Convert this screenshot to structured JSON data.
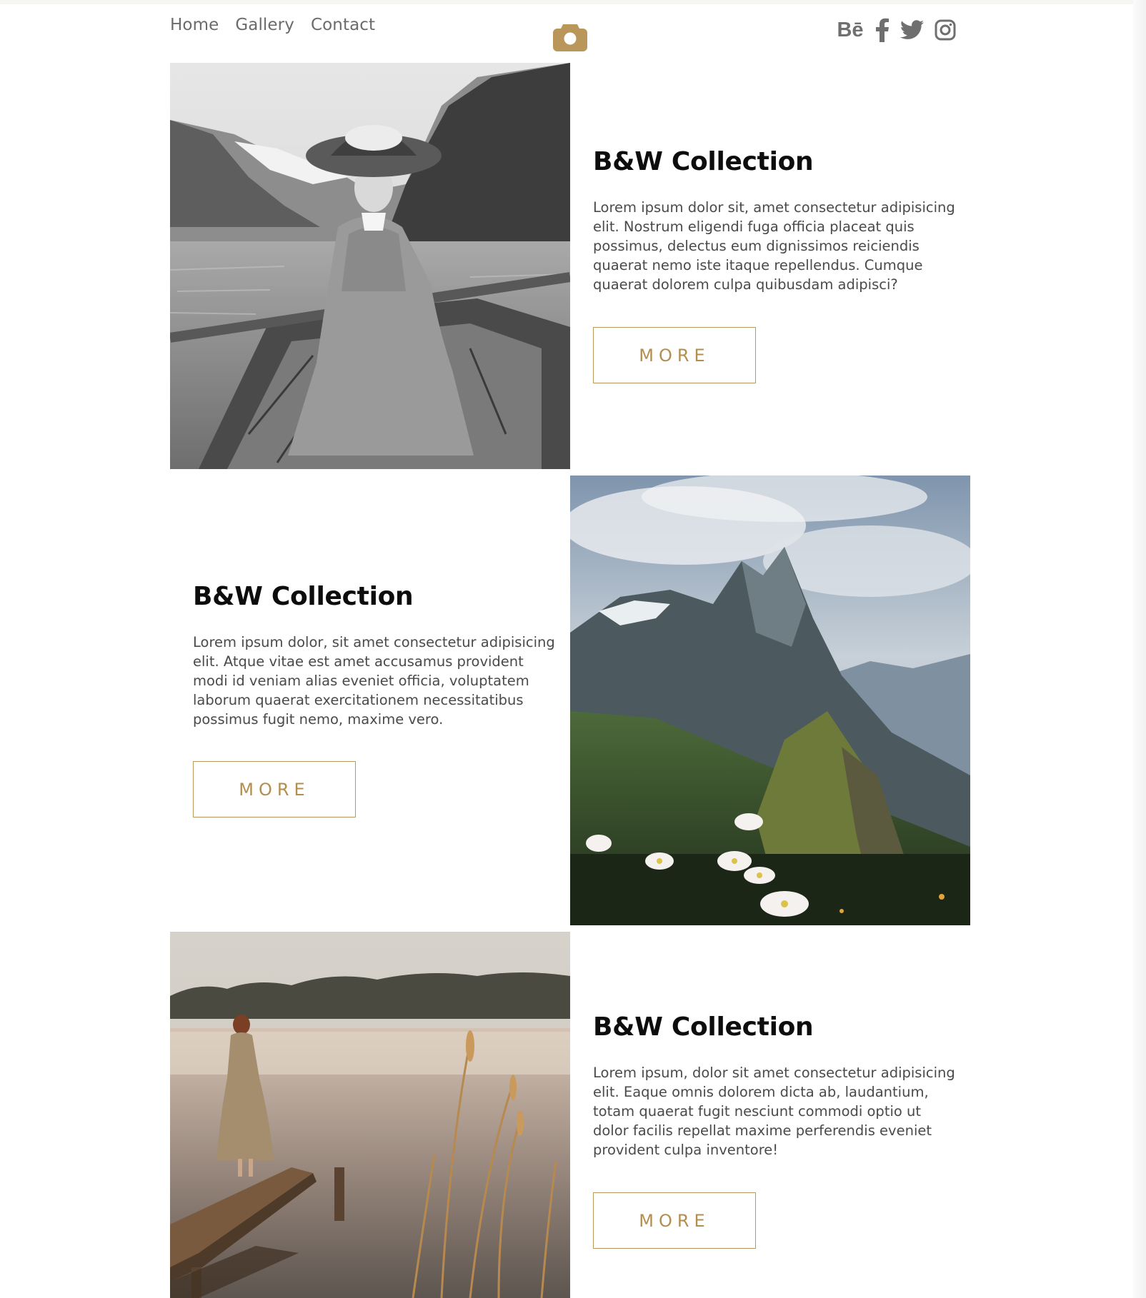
{
  "nav": {
    "items": [
      {
        "label": "Home"
      },
      {
        "label": "Gallery"
      },
      {
        "label": "Contact"
      }
    ]
  },
  "logo": {
    "icon": "camera-icon",
    "color": "#b9965a"
  },
  "social": {
    "behance": "Bē",
    "icons": [
      "behance-icon",
      "facebook-icon",
      "twitter-icon",
      "instagram-icon"
    ]
  },
  "sections": [
    {
      "title": "B&W Collection",
      "text": "Lorem ipsum dolor sit, amet consectetur adipisicing elit. Nostrum eligendi fuga officia placeat quis possimus, delectus eum dignissimos reiciendis quaerat nemo iste itaque repellendus. Cumque quaerat dolorem culpa quibusdam adipisci?",
      "button": "MORE",
      "image": "woman-rowing-boat-photo"
    },
    {
      "title": "B&W Collection",
      "text": "Lorem ipsum dolor, sit amet consectetur adipisicing elit. Atque vitae est amet accusamus provident modi id veniam alias eveniet officia, voluptatem laborum quaerat exercitationem necessitatibus possimus fugit nemo, maxime vero.",
      "button": "MORE",
      "image": "mountain-flowers-photo"
    },
    {
      "title": "B&W Collection",
      "text": "Lorem ipsum, dolor sit amet consectetur adipisicing elit. Eaque omnis dolorem dicta ab, laudantium, totam quaerat fugit nesciunt commodi optio ut dolor facilis repellat maxime perferendis eveniet provident culpa inventore!",
      "button": "MORE",
      "image": "woman-on-pier-photo"
    }
  ],
  "colors": {
    "accent": "#b9965a",
    "nav_text": "#6b6b6b",
    "heading": "#0d0d0d",
    "body_text": "#4a4a4a"
  }
}
